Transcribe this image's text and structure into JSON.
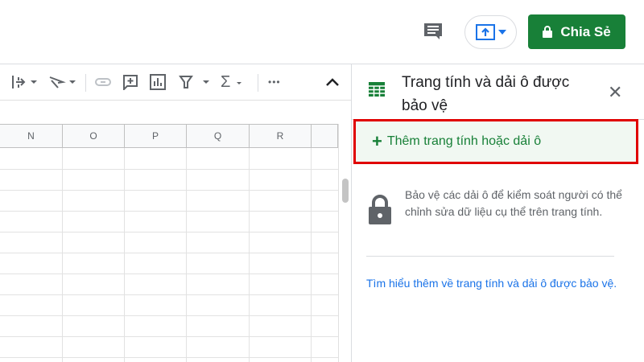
{
  "header": {
    "share_label": "Chia Sẻ",
    "icons": [
      "comment-icon",
      "present-icon",
      "lock-icon"
    ]
  },
  "toolbar": {
    "icons": [
      "text-wrap-icon",
      "text-rotate-icon",
      "link-icon",
      "insert-comment-icon",
      "insert-chart-icon",
      "filter-icon",
      "functions-icon",
      "more-icon",
      "collapse-icon"
    ],
    "more": "•••",
    "sigma": "Σ"
  },
  "grid": {
    "columns": [
      "N",
      "O",
      "P",
      "Q",
      "R"
    ]
  },
  "panel": {
    "title": "Trang tính và dải ô được bảo vệ",
    "add_label": "Thêm trang tính hoặc dải ô",
    "description": "Bảo vệ các dải ô để kiểm soát người có thể chỉnh sửa dữ liệu cụ thể trên trang tính.",
    "learn_more": "Tìm hiểu thêm về trang tính và dải ô được bảo vệ.",
    "accent": "#188038",
    "highlight": "#e00000"
  }
}
